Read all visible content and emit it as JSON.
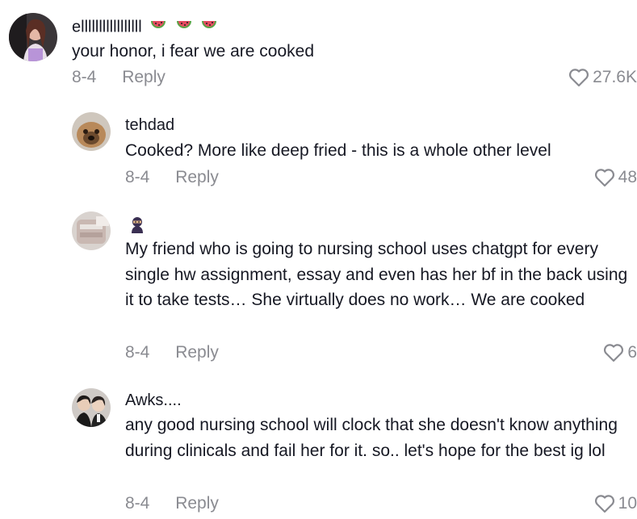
{
  "comments": [
    {
      "username": "elllllllllllllllll",
      "text": "your honor, i fear we are cooked",
      "date": "8-4",
      "reply_label": "Reply",
      "likes": "27.6K",
      "name_emojis": [
        "watermelon-icon",
        "watermelon-icon",
        "watermelon-icon"
      ]
    },
    {
      "username": "tehdad",
      "text": "Cooked? More like deep fried - this is a whole other level",
      "date": "8-4",
      "reply_label": "Reply",
      "likes": "48"
    },
    {
      "username": "",
      "name_emojis": [
        "ninja-icon"
      ],
      "text": "My friend who is going to nursing school uses chatgpt for every single hw assignment, essay and even has her bf in the back using it to take tests… She virtually does no work… We are cooked",
      "date": "8-4",
      "reply_label": "Reply",
      "likes": "6"
    },
    {
      "username": "Awks....",
      "text": "any good nursing school will clock that she doesn't know anything during clinicals and fail her for it. so.. let's hope for the best ig lol",
      "date": "8-4",
      "reply_label": "Reply",
      "likes": "10"
    }
  ],
  "colors": {
    "text": "#161823",
    "muted": "#8a8b91",
    "background": "#ffffff"
  }
}
